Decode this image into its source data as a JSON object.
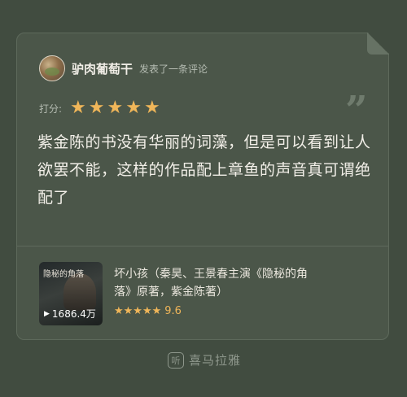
{
  "post": {
    "username": "驴肉葡萄干",
    "action": "发表了一条评论"
  },
  "rating": {
    "label": "打分:",
    "stars": [
      "★",
      "★",
      "★",
      "★",
      "★"
    ]
  },
  "comment": {
    "text": "紫金陈的书没有华丽的词藻，但是可以看到让人欲罢不能，这样的作品配上章鱼的声音真可谓绝配了"
  },
  "book": {
    "cover_title": "隐秘的角落",
    "plays": "1686.4万",
    "title": "坏小孩（秦昊、王景春主演《隐秘的角落》原著，紫金陈著）",
    "stars": "★★★★★",
    "score": "9.6"
  },
  "brand": {
    "icon_glyph": "听",
    "name": "喜马拉雅"
  },
  "icons": {
    "avatar": "user-avatar",
    "quote": "quote-icon",
    "play": "play-icon",
    "brand": "ximalaya-logo-icon"
  },
  "colors": {
    "background": "#414c40",
    "card": "#4b5649",
    "star": "#f0b659",
    "text": "#f2efe8"
  }
}
